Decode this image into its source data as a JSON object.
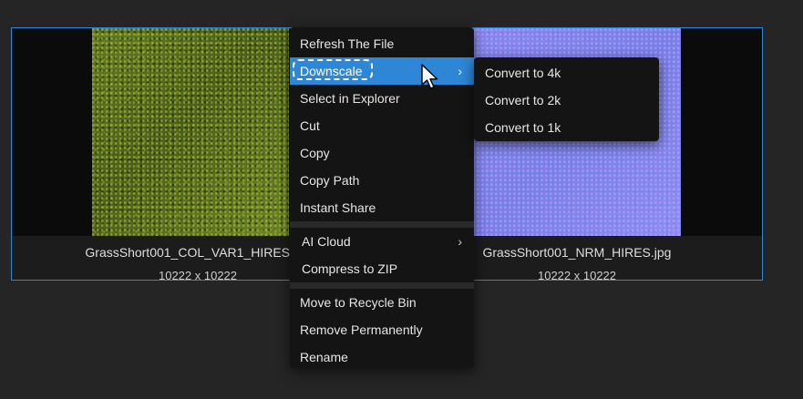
{
  "files": [
    {
      "name": "GrassShort001_COL_VAR1_HIRES.jpg",
      "dimensions": "10222 x 10222",
      "preview": "grass-texture"
    },
    {
      "name": "GrassShort001_NRM_HIRES.jpg",
      "dimensions": "10222 x 10222",
      "preview": "normal-map-texture"
    }
  ],
  "context_menu": {
    "refresh": "Refresh The File",
    "downscale": "Downscale",
    "select_explorer": "Select in Explorer",
    "cut": "Cut",
    "copy": "Copy",
    "copy_path": "Copy Path",
    "instant_share": "Instant Share",
    "ai_cloud": "AI Cloud",
    "compress_zip": "Compress to ZIP",
    "recycle": "Move to Recycle Bin",
    "remove": "Remove Permanently",
    "rename": "Rename",
    "submenu_chevron": "›"
  },
  "downscale_submenu": [
    "Convert to 4k",
    "Convert to 2k",
    "Convert to 1k"
  ],
  "colors": {
    "accent": "#2d87d6",
    "menu_bg": "#141414",
    "page_bg": "#252525"
  }
}
